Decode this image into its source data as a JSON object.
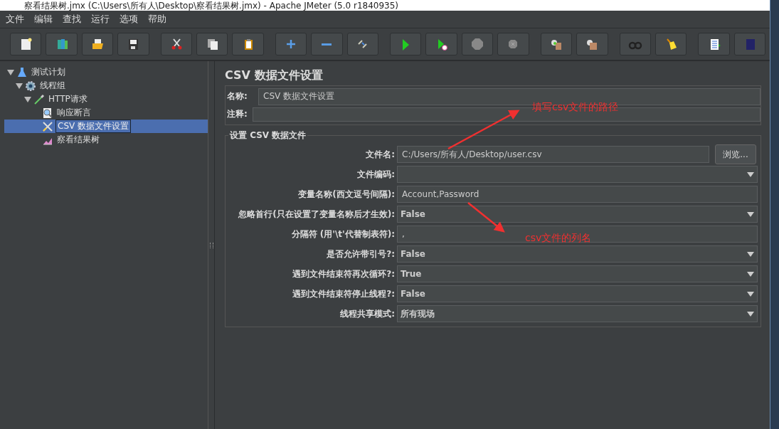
{
  "window": {
    "title": "察看结果树.jmx (C:\\Users\\所有人\\Desktop\\察看结果树.jmx) - Apache JMeter (5.0 r1840935)"
  },
  "menu": [
    "文件",
    "编辑",
    "查找",
    "运行",
    "选项",
    "帮助"
  ],
  "toolbar": [
    {
      "kind": "new",
      "gap": false
    },
    {
      "kind": "template",
      "gap": false
    },
    {
      "kind": "open",
      "gap": false
    },
    {
      "kind": "save",
      "gap": false
    },
    {
      "kind": "cut",
      "gap": true
    },
    {
      "kind": "copy",
      "gap": false
    },
    {
      "kind": "paste",
      "gap": false
    },
    {
      "kind": "expand",
      "gap": true
    },
    {
      "kind": "collapse",
      "gap": false
    },
    {
      "kind": "toggle",
      "gap": false
    },
    {
      "kind": "start",
      "gap": true
    },
    {
      "kind": "start-no-pause",
      "gap": false
    },
    {
      "kind": "stop",
      "gap": false
    },
    {
      "kind": "shutdown",
      "gap": false
    },
    {
      "kind": "clear",
      "gap": true
    },
    {
      "kind": "clear-all",
      "gap": false
    },
    {
      "kind": "search",
      "gap": true
    },
    {
      "kind": "reset",
      "gap": false
    },
    {
      "kind": "functions",
      "gap": true
    },
    {
      "kind": "help",
      "gap": false
    }
  ],
  "tree": [
    {
      "label": "测试计划",
      "kind": "flask",
      "expanded": true,
      "selected": false,
      "children": [
        {
          "label": "线程组",
          "kind": "gear",
          "expanded": true,
          "selected": false,
          "children": [
            {
              "label": "HTTP请求",
              "kind": "pipette",
              "expanded": true,
              "selected": false,
              "children": [
                {
                  "label": "响应断言",
                  "kind": "magnifier",
                  "selected": false
                },
                {
                  "label": "CSV 数据文件设置",
                  "kind": "tools",
                  "selected": true
                },
                {
                  "label": "察看结果树",
                  "kind": "chart",
                  "selected": false
                }
              ]
            }
          ]
        }
      ]
    }
  ],
  "panel": {
    "title": "CSV 数据文件设置",
    "name_label": "名称:",
    "name_value": "CSV 数据文件设置",
    "comment_label": "注释:",
    "group_title": "设置 CSV 数据文件",
    "rows": [
      {
        "kind": "file",
        "label": "文件名:",
        "value": "C:/Users/所有人/Desktop/user.csv",
        "button": "浏览..."
      },
      {
        "kind": "select",
        "label": "文件编码:"
      },
      {
        "kind": "text",
        "label": "变量名称(西文逗号间隔):",
        "value": "Account,Password"
      },
      {
        "kind": "select",
        "label": "忽略首行(只在设置了变量名称后才生效):",
        "value": "False"
      },
      {
        "kind": "text",
        "label": "分隔符 (用'\\t'代替制表符):",
        "value": ","
      },
      {
        "kind": "select",
        "label": "是否允许带引号?:",
        "value": "False"
      },
      {
        "kind": "select",
        "label": "遇到文件结束符再次循环?:",
        "value": "True"
      },
      {
        "kind": "select",
        "label": "遇到文件结束符停止线程?:",
        "value": "False"
      },
      {
        "kind": "select",
        "label": "线程共享模式:",
        "value": "所有现场"
      }
    ]
  },
  "annotations": [
    {
      "text": "填写csv文件的路径"
    },
    {
      "text": "csv文件的列名"
    }
  ]
}
